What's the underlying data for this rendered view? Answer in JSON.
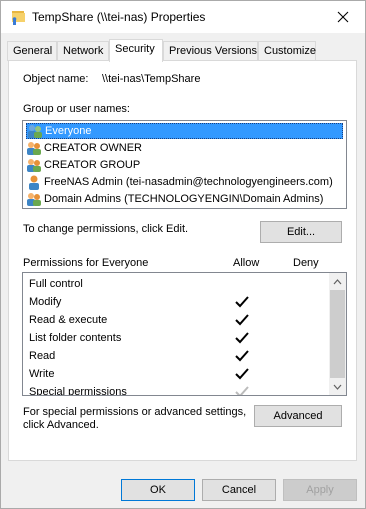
{
  "window": {
    "title": "TempShare (\\\\tei-nas) Properties",
    "close_symbol": "✕"
  },
  "tabs": [
    {
      "label": "General",
      "active": false
    },
    {
      "label": "Network",
      "active": false
    },
    {
      "label": "Security",
      "active": true
    },
    {
      "label": "Previous Versions",
      "active": false
    },
    {
      "label": "Customize",
      "active": false
    }
  ],
  "security": {
    "object_name_label": "Object name:",
    "object_name_value": "\\\\tei-nas\\TempShare",
    "group_label": "Group or user names:",
    "groups": [
      {
        "name": "Everyone",
        "icon": "group-icon",
        "selected": true
      },
      {
        "name": "CREATOR OWNER",
        "icon": "group-icon",
        "selected": false
      },
      {
        "name": "CREATOR GROUP",
        "icon": "group-icon",
        "selected": false
      },
      {
        "name": "FreeNAS Admin (tei-nasadmin@technologyengineers.com)",
        "icon": "user-icon",
        "selected": false
      },
      {
        "name": "Domain Admins (TECHNOLOGYENGIN\\Domain Admins)",
        "icon": "group-icon",
        "selected": false
      }
    ],
    "change_text": "To change permissions, click Edit.",
    "edit_button": "Edit...",
    "permissions_for": "Permissions for Everyone",
    "allow_header": "Allow",
    "deny_header": "Deny",
    "permissions": [
      {
        "name": "Full control",
        "allow": false
      },
      {
        "name": "Modify",
        "allow": true
      },
      {
        "name": "Read & execute",
        "allow": true
      },
      {
        "name": "List folder contents",
        "allow": true
      },
      {
        "name": "Read",
        "allow": true
      },
      {
        "name": "Write",
        "allow": true
      },
      {
        "name": "Special permissions",
        "allow": true
      }
    ],
    "advanced_text_1": "For special permissions or advanced settings,",
    "advanced_text_2": "click Advanced.",
    "advanced_button": "Advanced"
  },
  "footer": {
    "ok": "OK",
    "cancel": "Cancel",
    "apply": "Apply"
  },
  "colors": {
    "selection": "#3399ff",
    "accent": "#0078d7",
    "check": "#000000"
  }
}
